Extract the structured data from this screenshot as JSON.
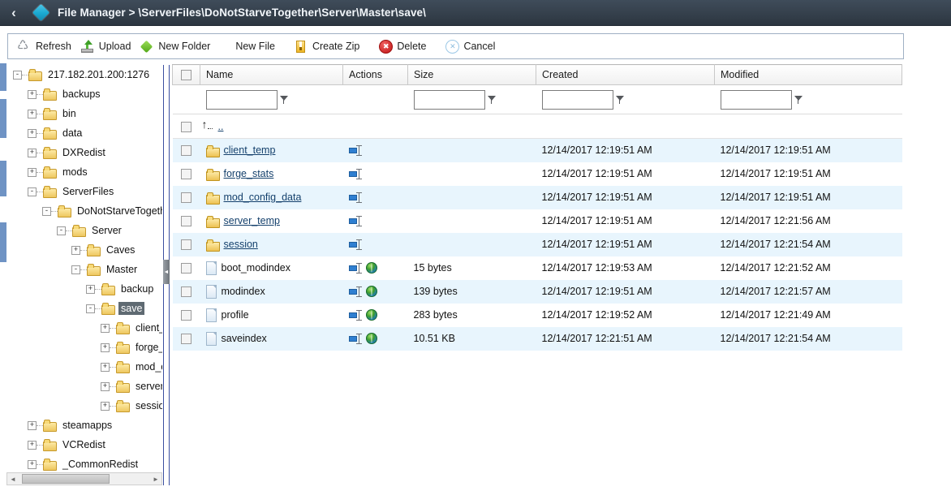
{
  "topbar": {
    "back_label": "‹",
    "app_title": "File Manager",
    "separator": ">",
    "path": "\\ServerFiles\\DoNotStarveTogether\\Server\\Master\\save\\",
    "title_full": "File Manager > \\ServerFiles\\DoNotStarveTogether\\Server\\Master\\save\\"
  },
  "toolbar": {
    "refresh_label": "Refresh",
    "upload_label": "Upload",
    "new_folder_label": "New Folder",
    "new_file_label": "New File",
    "create_zip_label": "Create Zip",
    "delete_label": "Delete",
    "cancel_label": "Cancel"
  },
  "tree": {
    "root_label": "217.182.201.200:1276",
    "selected": "save",
    "nodes": [
      {
        "label": "217.182.201.200:1276",
        "depth": 0,
        "toggle": "-",
        "selected": false
      },
      {
        "label": "backups",
        "depth": 1,
        "toggle": "+",
        "selected": false
      },
      {
        "label": "bin",
        "depth": 1,
        "toggle": "+",
        "selected": false
      },
      {
        "label": "data",
        "depth": 1,
        "toggle": "+",
        "selected": false
      },
      {
        "label": "DXRedist",
        "depth": 1,
        "toggle": "+",
        "selected": false
      },
      {
        "label": "mods",
        "depth": 1,
        "toggle": "+",
        "selected": false
      },
      {
        "label": "ServerFiles",
        "depth": 1,
        "toggle": "-",
        "selected": false
      },
      {
        "label": "DoNotStarveTogether",
        "depth": 2,
        "toggle": "-",
        "selected": false
      },
      {
        "label": "Server",
        "depth": 3,
        "toggle": "-",
        "selected": false
      },
      {
        "label": "Caves",
        "depth": 4,
        "toggle": "+",
        "selected": false
      },
      {
        "label": "Master",
        "depth": 4,
        "toggle": "-",
        "selected": false
      },
      {
        "label": "backup",
        "depth": 5,
        "toggle": "+",
        "selected": false
      },
      {
        "label": "save",
        "depth": 5,
        "toggle": "-",
        "selected": true
      },
      {
        "label": "client_t",
        "depth": 6,
        "toggle": "+",
        "selected": false
      },
      {
        "label": "forge_s",
        "depth": 6,
        "toggle": "+",
        "selected": false
      },
      {
        "label": "mod_co",
        "depth": 6,
        "toggle": "+",
        "selected": false
      },
      {
        "label": "server_",
        "depth": 6,
        "toggle": "+",
        "selected": false
      },
      {
        "label": "session",
        "depth": 6,
        "toggle": "+",
        "selected": false
      },
      {
        "label": "steamapps",
        "depth": 1,
        "toggle": "+",
        "selected": false
      },
      {
        "label": "VCRedist",
        "depth": 1,
        "toggle": "+",
        "selected": false
      },
      {
        "label": "_CommonRedist",
        "depth": 1,
        "toggle": "+",
        "selected": false
      }
    ],
    "scroll_left_arrow": "◄",
    "scroll_right_arrow": "►"
  },
  "splitter": {
    "collapse_arrow": "◄"
  },
  "grid": {
    "columns": [
      "Name",
      "Actions",
      "Size",
      "Created",
      "Modified"
    ],
    "filters": {
      "name": "",
      "size": "",
      "created": "",
      "modified": "",
      "placeholder": ""
    },
    "parent_row": {
      "name": "..",
      "icon": "up-folder-icon"
    },
    "rows": [
      {
        "name": "client_temp",
        "type": "folder",
        "size": "",
        "created": "12/14/2017 12:19:51 AM",
        "modified": "12/14/2017 12:19:51 AM"
      },
      {
        "name": "forge_stats",
        "type": "folder",
        "size": "",
        "created": "12/14/2017 12:19:51 AM",
        "modified": "12/14/2017 12:19:51 AM"
      },
      {
        "name": "mod_config_data",
        "type": "folder",
        "size": "",
        "created": "12/14/2017 12:19:51 AM",
        "modified": "12/14/2017 12:19:51 AM"
      },
      {
        "name": "server_temp",
        "type": "folder",
        "size": "",
        "created": "12/14/2017 12:19:51 AM",
        "modified": "12/14/2017 12:21:56 AM"
      },
      {
        "name": "session",
        "type": "folder",
        "size": "",
        "created": "12/14/2017 12:19:51 AM",
        "modified": "12/14/2017 12:21:54 AM"
      },
      {
        "name": "boot_modindex",
        "type": "file",
        "size": "15 bytes",
        "created": "12/14/2017 12:19:53 AM",
        "modified": "12/14/2017 12:21:52 AM"
      },
      {
        "name": "modindex",
        "type": "file",
        "size": "139 bytes",
        "created": "12/14/2017 12:19:51 AM",
        "modified": "12/14/2017 12:21:57 AM"
      },
      {
        "name": "profile",
        "type": "file",
        "size": "283 bytes",
        "created": "12/14/2017 12:19:52 AM",
        "modified": "12/14/2017 12:21:49 AM"
      },
      {
        "name": "saveindex",
        "type": "file",
        "size": "10.51 KB",
        "created": "12/14/2017 12:21:51 AM",
        "modified": "12/14/2017 12:21:54 AM"
      }
    ]
  },
  "colors": {
    "topbar": "#36414d",
    "accent": "#19a8d0",
    "row_alt": "#e8f5fd",
    "selection": "#5f6a72",
    "link": "#14406c"
  }
}
